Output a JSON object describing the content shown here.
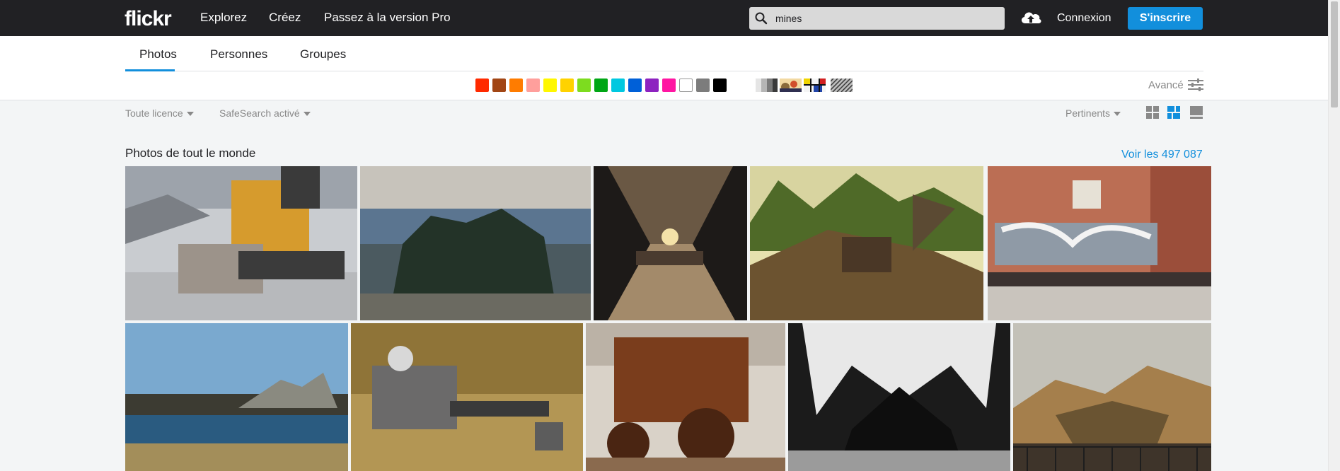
{
  "topbar": {
    "logo": "flickr",
    "nav": [
      "Explorez",
      "Créez",
      "Passez à la version Pro"
    ],
    "search_value": "mines",
    "login": "Connexion",
    "signup": "S'inscrire"
  },
  "tabs": [
    "Photos",
    "Personnes",
    "Groupes"
  ],
  "colors": {
    "swatches": [
      "#ff2a00",
      "#a24615",
      "#ff7c00",
      "#ff9f9c",
      "#fff700",
      "#ffd200",
      "#7ddc1f",
      "#00a615",
      "#00c8e0",
      "#0060d8",
      "#8d22c0",
      "#ff16a2",
      "#ffffff",
      "#7c7c7c",
      "#000000"
    ],
    "accent": "#128fdc"
  },
  "advanced": "Avancé",
  "filters": {
    "license": "Toute licence",
    "safesearch": "SafeSearch activé",
    "sort": "Pertinents"
  },
  "section": {
    "title": "Photos de tout le monde",
    "see_all": "Voir les 497 087"
  },
  "icons": {
    "search": "search-icon",
    "upload": "cloud-upload-icon",
    "advanced": "sliders-icon"
  }
}
